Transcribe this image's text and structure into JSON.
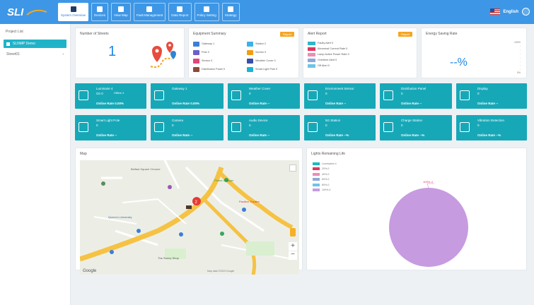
{
  "header": {
    "logo_text": "SLI",
    "nav": [
      {
        "label": "System Overview",
        "active": true
      },
      {
        "label": "Devices",
        "active": false
      },
      {
        "label": "View Map",
        "active": false
      },
      {
        "label": "Fault Management",
        "active": false
      },
      {
        "label": "Data Report",
        "active": false
      },
      {
        "label": "Policy Setting",
        "active": false
      },
      {
        "label": "Strategy",
        "active": false
      }
    ],
    "language": "English"
  },
  "sidebar": {
    "title": "Project List",
    "project": "SLNMP Demo",
    "sub_item": "Street01"
  },
  "streets": {
    "title": "Number of Streets",
    "value": "1"
  },
  "equipment": {
    "title": "Equipment Summary",
    "report_label": "Report",
    "items": [
      {
        "label": "Gateway 1",
        "color": "#3d7fd6"
      },
      {
        "label": "Station 2",
        "color": "#3bb2e8"
      },
      {
        "label": "Pole 3",
        "color": "#6b5fc9"
      },
      {
        "label": "Screen 0",
        "color": "#f39c12"
      },
      {
        "label": "Sensor 0",
        "color": "#e0477a"
      },
      {
        "label": "Weather Cover 0",
        "color": "#3a4fa8"
      },
      {
        "label": "Distribution Panel 0",
        "color": "#8e4a3a"
      },
      {
        "label": "Smart Light Pole 0",
        "color": "#1bb3d6"
      }
    ]
  },
  "alert": {
    "title": "Alert Report",
    "report_label": "Report",
    "items": [
      {
        "label": "Faulty Alert 0",
        "color": "#2fb6c9"
      },
      {
        "label": "Abnormal Current Rate 0",
        "color": "#e0365f"
      },
      {
        "label": "Lamp Active Power Rate 0",
        "color": "#e98fb3"
      },
      {
        "label": "Overtime Alert 0",
        "color": "#8ea8d9"
      },
      {
        "label": "Off Alert 0",
        "color": "#6ec4e6"
      }
    ]
  },
  "energy": {
    "title": "Energy Saving Rate",
    "value": "--%",
    "scale_top": "100%",
    "scale_bottom": "0%"
  },
  "tiles_row1": [
    {
      "name": "Luminaire 4",
      "value": "Online Rate 0.00%",
      "sub1": "On 0",
      "sub2": "Offline 4"
    },
    {
      "name": "Gateway 1",
      "value": "Online Rate 0.00%",
      "sub1": "",
      "sub2": ""
    },
    {
      "name": "Weather Cover",
      "value": "Online Rate --",
      "sub1": "0",
      "sub2": ""
    },
    {
      "name": "Environment Sensor",
      "value": "Online Rate --",
      "sub1": "0",
      "sub2": ""
    },
    {
      "name": "Distribution Panel",
      "value": "Online Rate --",
      "sub1": "0",
      "sub2": ""
    },
    {
      "name": "Display",
      "value": "Online Rate --",
      "sub1": "0",
      "sub2": ""
    }
  ],
  "tiles_row2": [
    {
      "name": "Smart Light Pole",
      "value": "Online Rate --",
      "sub1": "0"
    },
    {
      "name": "Camera",
      "value": "Online Rate --",
      "sub1": "0"
    },
    {
      "name": "Audio Device",
      "value": "Online Rate --",
      "sub1": "0"
    },
    {
      "name": "5G Station",
      "value": "Online Rate --%",
      "sub1": "0"
    },
    {
      "name": "Charge Station",
      "value": "Online Rate --%",
      "sub1": "0"
    },
    {
      "name": "Vibration Detection",
      "value": "Online Rate --%",
      "sub1": "0"
    }
  ],
  "map": {
    "title": "Map",
    "labels": [
      "Belfast Square Chrome",
      "Phone Charger",
      "Pavilion Theatre",
      "Queen's University",
      "The Sunny Shop",
      "Google",
      "Map data ©2023 Google"
    ],
    "marker_count": "2"
  },
  "lights": {
    "title": "Lights Remaining Life",
    "legend": [
      {
        "label": "Luminaires 4",
        "color": "#1fb6c7"
      },
      {
        "label": "20%-0",
        "color": "#e0365f"
      },
      {
        "label": "40%-0",
        "color": "#e98fb3"
      },
      {
        "label": "60%-0",
        "color": "#8ea8d9"
      },
      {
        "label": "80%-0",
        "color": "#6ec4e6"
      },
      {
        "label": "100%-4",
        "color": "#c79be0"
      }
    ],
    "pie_label": "100%-4",
    "pie_color": "#c79be0"
  }
}
